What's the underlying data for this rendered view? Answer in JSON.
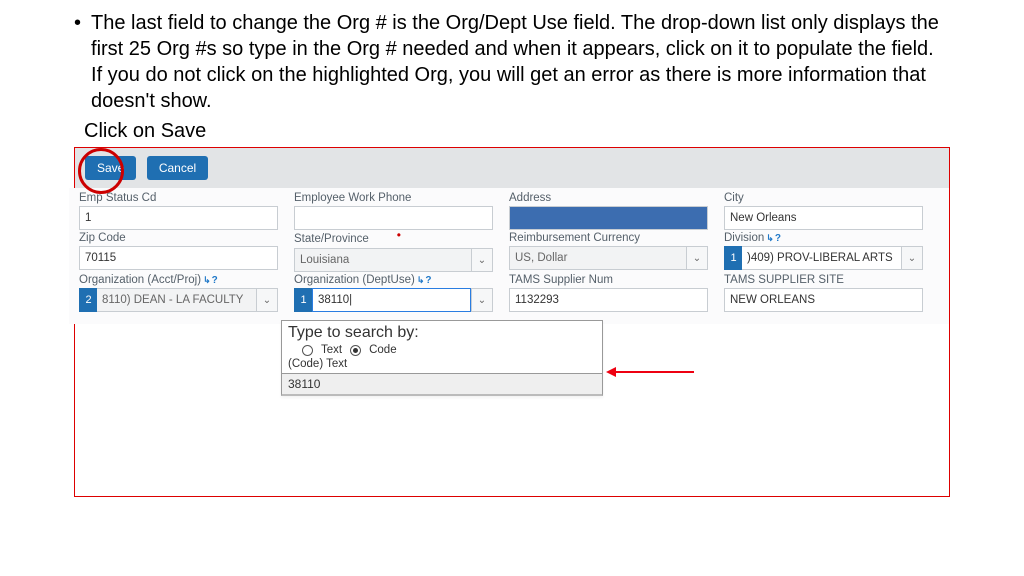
{
  "bullet_text": "The last field to change the Org # is the Org/Dept Use field. The drop-down list only displays the first 25 Org #s so type in the Org # needed and when it appears, click on it to populate the field. If you do not click on the highlighted Org, you will get an error as there is more information that doesn't show.",
  "subtext": "Click on Save",
  "toolbar": {
    "save_label": "Save",
    "cancel_label": "Cancel"
  },
  "row1": {
    "emp_status_label": "Emp Status Cd",
    "emp_status_value": "1",
    "work_phone_label": "Employee Work Phone",
    "work_phone_value": "",
    "address_label": "Address",
    "city_label": "City",
    "city_value": "New Orleans"
  },
  "row2": {
    "zip_label": "Zip Code",
    "zip_value": "70115",
    "state_label": "State/Province",
    "state_value": "Louisiana",
    "curr_label": "Reimbursement Currency",
    "curr_value": "US, Dollar",
    "div_label": "Division",
    "div_badge": "1",
    "div_value": ")409) PROV-LIBERAL ARTS"
  },
  "row3": {
    "org_ap_label": "Organization (Acct/Proj)",
    "org_ap_badge": "2",
    "org_ap_value": "8110) DEAN - LA FACULTY",
    "org_du_label": "Organization (DeptUse)",
    "org_du_badge": "1",
    "org_du_value": "38110|",
    "supplier_label": "TAMS Supplier Num",
    "supplier_value": "1132293",
    "site_label": "TAMS SUPPLIER SITE",
    "site_value": "NEW ORLEANS"
  },
  "popup": {
    "title": "Type to search by:",
    "opt_text": "Text",
    "opt_code": "Code",
    "sub": "(Code) Text",
    "result": "38110"
  },
  "help": "?"
}
